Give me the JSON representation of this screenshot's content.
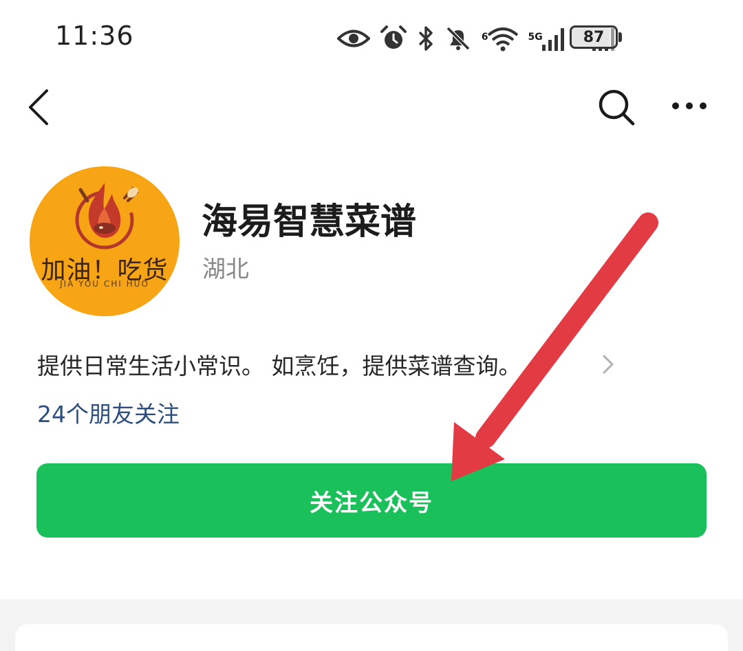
{
  "status_bar": {
    "time": "11:36",
    "battery": "87",
    "wifi_label": "6",
    "signal1_label": "5G",
    "signal2_label": "5G",
    "icons": [
      "eye-icon",
      "alarm-icon",
      "bluetooth-icon",
      "mute-icon",
      "wifi-icon",
      "signal-icon",
      "signal-icon",
      "battery-icon"
    ]
  },
  "nav": {
    "back_icon": "chevron-left-icon",
    "search_icon": "search-icon",
    "more_icon": "more-horizontal-icon"
  },
  "account": {
    "name": "海易智慧菜谱",
    "region": "湖北",
    "avatar": {
      "text_cn": "加油！吃货",
      "text_en": "JIA YOU CHI HUO",
      "bg_color": "#f8a515"
    },
    "description": "提供日常生活小常识。 如烹饪，提供菜谱查询。",
    "friends_following": "24个朋友关注"
  },
  "follow_button": {
    "label": "关注公众号",
    "color": "#1ac15a"
  },
  "annotation": {
    "arrow_color": "#e23b44"
  }
}
